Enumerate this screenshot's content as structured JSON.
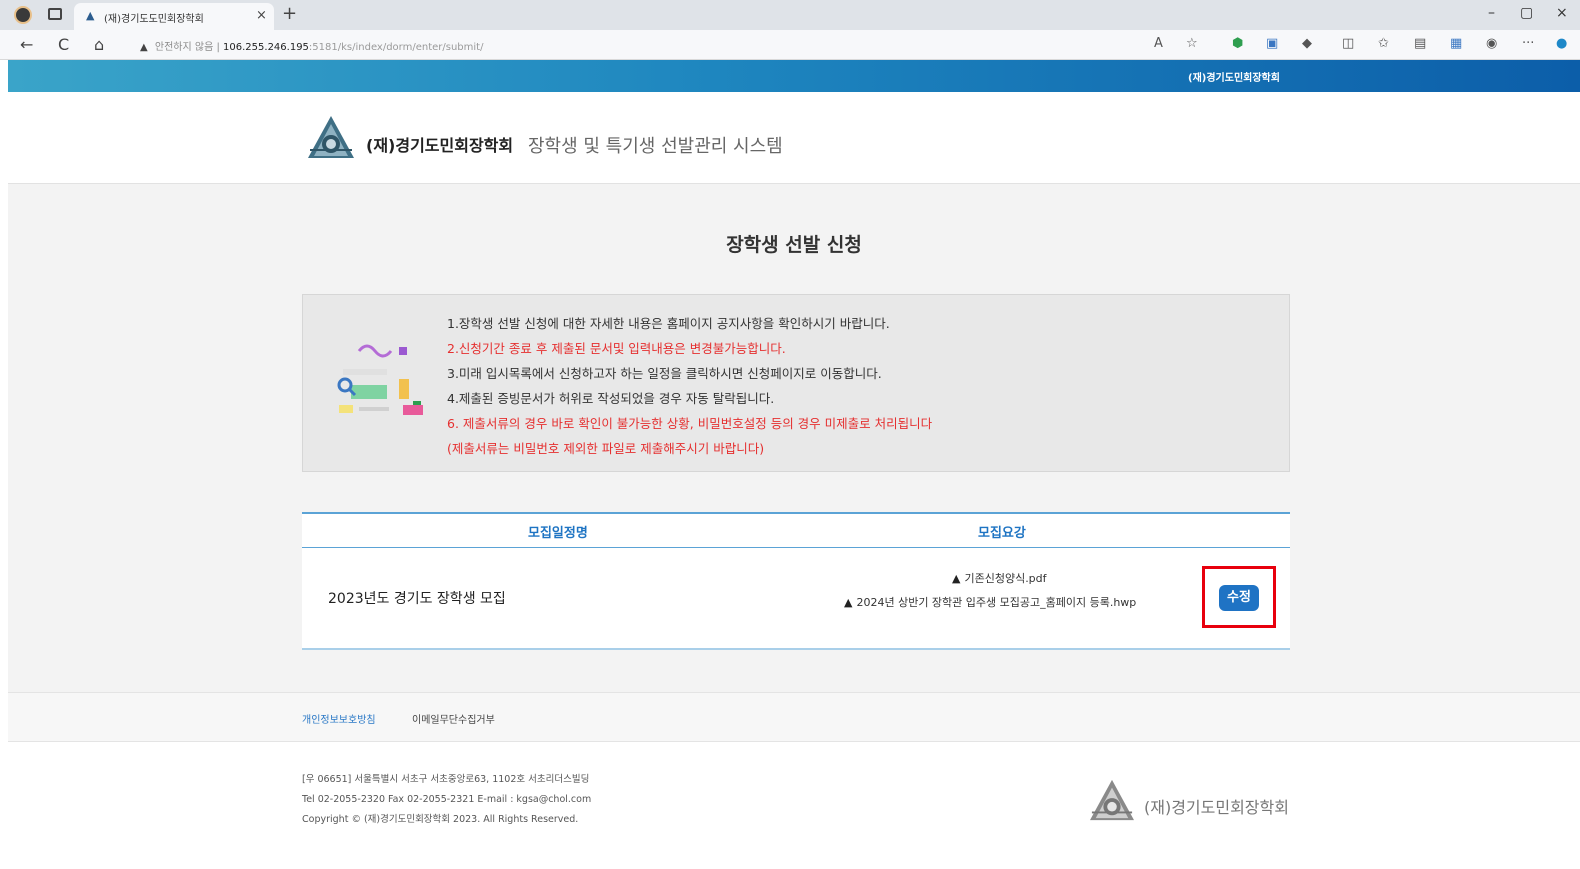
{
  "browser": {
    "tab_title": "(재)경기도도민회장학회",
    "tab_close": "×",
    "new_tab": "+",
    "url_warning": "▲",
    "url_insecure": "안전하지 않음",
    "url_separator": "|",
    "url_host": "106.255.246.195",
    "url_path": ":5181/ks/index/dorm/enter/submit/",
    "nav_back": "←",
    "nav_refresh": "C",
    "nav_home": "⌂",
    "win_min": "–",
    "win_max": "▢",
    "win_close": "×"
  },
  "topstrip": {
    "label": "(재)경기도민회장학회"
  },
  "header": {
    "org_name": "(재)경기도민회장학회",
    "system_name": "장학생 및 특기생 선발관리 시스템"
  },
  "page": {
    "title": "장학생 선발 신청"
  },
  "notice": {
    "lines": [
      {
        "text": "1.장학생 선발 신청에 대한 자세한 내용은 홈페이지 공지사항을 확인하시기 바랍니다.",
        "red": false
      },
      {
        "text": "2.신청기간 종료 후 제출된 문서및 입력내용은 변경불가능합니다.",
        "red": true
      },
      {
        "text": "3.미래 입시목록에서 신청하고자 하는 일정을 클릭하시면 신청페이지로 이동합니다.",
        "red": false
      },
      {
        "text": "4.제출된 증빙문서가 허위로 작성되었을 경우 자동 탈락됩니다.",
        "red": false
      },
      {
        "text": "6. 제출서류의 경우 바로 확인이 불가능한 상황, 비밀번호설정 등의 경우 미제출로 처리됩니다",
        "red": true
      },
      {
        "text": "(제출서류는 비밀번호 제외한 파일로 제출해주시기 바랍니다)",
        "red": true
      }
    ]
  },
  "table": {
    "headers": [
      "모집일정명",
      "모집요강"
    ],
    "rows": [
      {
        "title": "2023년도 경기도 장학생 모집",
        "files": [
          "기존신청양식.pdf",
          "2024년 상반기 장학관 입주생 모집공고_홈페이지 등록.hwp"
        ],
        "download_icon": "▲",
        "action": "수정"
      }
    ]
  },
  "footer": {
    "links": [
      "개인정보보호방침",
      "이메일무단수집거부"
    ],
    "address_lines": [
      "[우 06651] 서울특별시 서초구 서초중앙로63, 1102호 서초리더스빌딩",
      "Tel 02-2055-2320 Fax 02-2055-2321 E-mail : kgsa@chol.com",
      "Copyright © (재)경기도민회장학회 2023. All Rights Reserved."
    ],
    "org_name": "(재)경기도민회장학회"
  },
  "colors": {
    "accent_blue": "#1f73c4",
    "highlight_red": "#e8000d",
    "notice_red": "#e53030"
  }
}
